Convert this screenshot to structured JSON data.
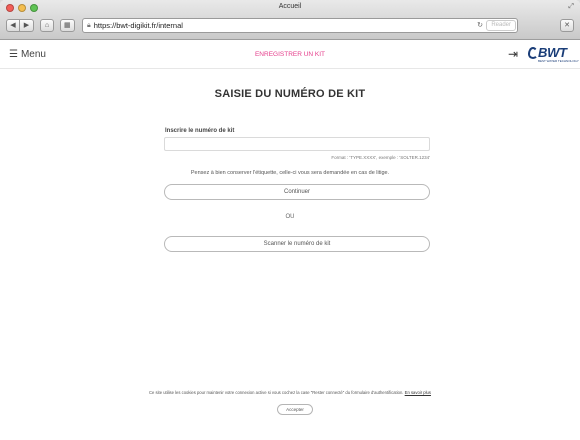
{
  "browser": {
    "window_title": "Accueil",
    "url": "https://bwt-digikit.fr/internal",
    "reader_label": "Reader",
    "icons": {
      "back": "back-icon",
      "forward": "forward-icon",
      "home": "home-icon",
      "bookmarks": "bookmarks-icon",
      "secure": "lock-icon",
      "reload": "reload-icon",
      "stop": "stop-icon",
      "resize": "resize-icon"
    }
  },
  "header": {
    "menu_label": "Menu",
    "register_link": "ENREGISTRER UN KIT",
    "logo_text": "BWT",
    "logo_subtitle": "BEST WATER TECHNOLOGY",
    "accent_color": "#e53d8b",
    "brand_color": "#1a3d78"
  },
  "main": {
    "title": "SAISIE DU NUMÉRO DE KIT",
    "field_label": "Inscrire le numéro de kit",
    "field_value": "",
    "format_hint": "Format : 'TYPE.XXXX', exemple : 'SOLTER.1234'",
    "info_text": "Pensez à bien conserver l'étiquette, celle-ci vous sera demandée en cas de litige.",
    "continue_label": "Continuer",
    "or_label": "OU",
    "scan_label": "Scanner le numéro de kit"
  },
  "cookie": {
    "text": "Ce site utilise les cookies pour maintenir votre connexion active si vous cochez la case \"Rester connecté\" du formulaire d'authentification.",
    "link_label": "En savoir plus",
    "accept_label": "Accepter"
  }
}
